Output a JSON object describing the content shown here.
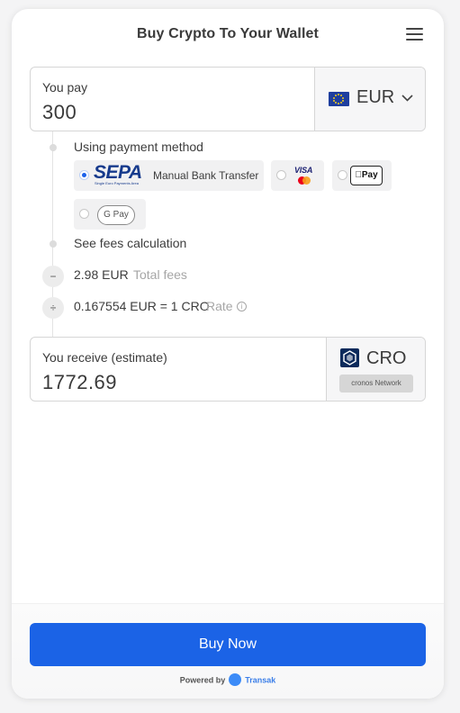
{
  "header": {
    "title": "Buy Crypto To Your Wallet",
    "menu_icon": "hamburger-menu-icon"
  },
  "pay": {
    "label": "You pay",
    "value": "300",
    "currency": "EUR",
    "currency_icon": "eu-flag-icon"
  },
  "payment": {
    "label": "Using payment method",
    "options": [
      {
        "name": "sepa",
        "logo_text": "SEPA",
        "logo_subtext": "Single Euro Payments Area",
        "label": "Manual Bank Transfer",
        "selected": true
      },
      {
        "name": "visa-mastercard",
        "logo_text": "VISA",
        "selected": false
      },
      {
        "name": "apple-pay",
        "logo_text": "Pay",
        "selected": false
      },
      {
        "name": "google-pay",
        "logo_text": "G Pay",
        "selected": false
      }
    ]
  },
  "fees": {
    "calc_label": "See fees calculation",
    "minus_symbol": "−",
    "fees_value": "2.98 EUR",
    "fees_label": "Total fees",
    "divide_symbol": "÷",
    "rate_value": "0.167554 EUR = 1 CRO",
    "rate_label": "Rate",
    "info_icon": "i"
  },
  "receive": {
    "label": "You receive (estimate)",
    "value": "1772.69",
    "currency": "CRO",
    "network": "cronos Network",
    "currency_icon": "cronos-icon"
  },
  "footer": {
    "button_label": "Buy Now",
    "powered_label": "Powered by",
    "brand": "Transak"
  },
  "colors": {
    "accent": "#1b63e6",
    "brand_link": "#3c7fe8"
  }
}
